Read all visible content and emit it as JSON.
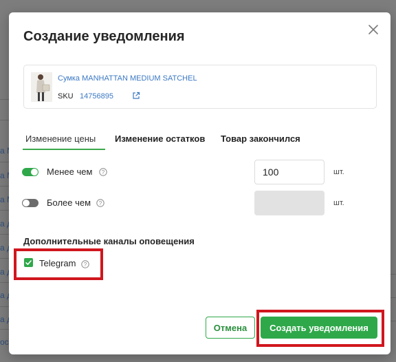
{
  "background": {
    "link_fragments": [
      "а М",
      "а М",
      "а М",
      "а д",
      "а д",
      "а д",
      "а д",
      "а д",
      "ос"
    ]
  },
  "modal": {
    "title": "Создание уведомления",
    "close_icon": "close-icon",
    "product": {
      "name": "Сумка MANHATTAN MEDIUM SATCHEL",
      "sku_label": "SKU",
      "sku_value": "14756895",
      "link_icon": "external-link-icon"
    },
    "tabs": [
      {
        "label": "Изменение цены",
        "active": true
      },
      {
        "label": "Изменение остатков",
        "active": false
      },
      {
        "label": "Товар закончился",
        "active": false
      }
    ],
    "conditions": [
      {
        "label": "Менее чем",
        "enabled": true,
        "value": "100",
        "unit": "шт."
      },
      {
        "label": "Более чем",
        "enabled": false,
        "value": "",
        "unit": "шт."
      }
    ],
    "channels_title": "Дополнительные каналы оповещения",
    "channels": [
      {
        "label": "Telegram",
        "checked": true
      }
    ],
    "buttons": {
      "cancel": "Отмена",
      "create": "Создать уведомления"
    }
  },
  "colors": {
    "accent": "#2fa84a",
    "link": "#3b79c3",
    "highlight": "#d0161e",
    "toggle_off": "#6c6c6c"
  }
}
